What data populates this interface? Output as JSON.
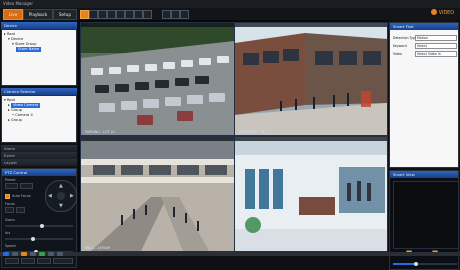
{
  "window": {
    "title": "Video Manager"
  },
  "top_tabs": [
    {
      "label": "Live"
    },
    {
      "label": "Playback"
    },
    {
      "label": "Setup"
    }
  ],
  "brand": {
    "text": "VIDEO"
  },
  "left_panels": {
    "devices": {
      "title": "Device",
      "tree": [
        {
          "label": "Root"
        },
        {
          "label": "Device"
        },
        {
          "label": "Store Group"
        },
        {
          "label": "Store Name"
        }
      ]
    },
    "camera_list": {
      "title": "Camera Selector",
      "tree": [
        {
          "label": "Root"
        },
        {
          "label": "Video Camera"
        },
        {
          "label": "Group"
        },
        {
          "label": "Camera 4"
        },
        {
          "label": "Group"
        }
      ]
    },
    "collapsed": [
      {
        "label": "Alarm"
      },
      {
        "label": "Event"
      },
      {
        "label": "Layout"
      }
    ],
    "ptz": {
      "title": "PTZ Control",
      "preset_label": "Preset",
      "focus_label": "Focus",
      "zoom_label": "Zoom",
      "iris_label": "Iris",
      "speed_label": "Speed",
      "auto_focus_label": "Auto Focus",
      "speed_value": 0.45,
      "zoom_value": 0.55,
      "iris_value": 0.4
    }
  },
  "right_panel": {
    "search": {
      "title": "Smart Find",
      "fields": [
        {
          "key": "Detection Type",
          "value": "Motion"
        },
        {
          "key": "Keyword",
          "value": "Select"
        },
        {
          "key": "Video",
          "value": "Select Video In"
        }
      ]
    },
    "player": {
      "title": "Smart View",
      "controls": [
        "⏮",
        "⏪",
        "⏯",
        "⏩",
        "⏭"
      ],
      "progress_value": 0.35
    }
  },
  "cameras": [
    {
      "caption": "PARKING - LOT 01",
      "scene": "parking"
    },
    {
      "caption": "ENTRANCE - 01",
      "scene": "street"
    },
    {
      "caption": "MALL - ATRIUM",
      "scene": "mall"
    },
    {
      "caption": "STORE - 02",
      "scene": "store"
    }
  ]
}
